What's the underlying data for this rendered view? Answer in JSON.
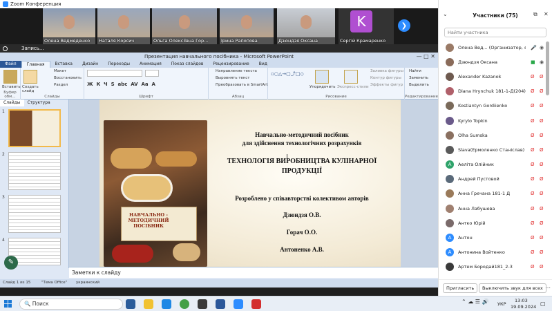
{
  "zoom_window": {
    "title": "Zoom Конференция"
  },
  "gallery": {
    "tiles": [
      {
        "name": "Олена Ведмеденко"
      },
      {
        "name": "Наталя Корсич"
      },
      {
        "name": "Ольга Олексіївна Гор..."
      },
      {
        "name": "Ірина Рапопова"
      },
      {
        "name": "Дзюндзя Оксана"
      },
      {
        "name": "Сергій Крамаренко",
        "initial": "K"
      }
    ]
  },
  "recording": {
    "label": "Запись..."
  },
  "powerpoint": {
    "window_title": "Презентация навчального посібника - Microsoft PowerPoint",
    "tabs": [
      "Файл",
      "Главная",
      "Вставка",
      "Дизайн",
      "Переходы",
      "Анимация",
      "Показ слайдов",
      "Рецензирование",
      "Вид"
    ],
    "ribbon": {
      "paste": "Вставить",
      "new_slide": "Создать слайд",
      "layout": "Макет",
      "reset": "Восстановить",
      "section": "Раздел",
      "text_direction": "Направление текста",
      "align_text": "Выровнять текст",
      "smartart": "Преобразовать в SmartArt",
      "arrange": "Упорядочить",
      "quick_styles": "Экспресс-стили",
      "shape_fill": "Заливка фигуры",
      "shape_outline": "Контур фигуры",
      "shape_effects": "Эффекты фигур",
      "find": "Найти",
      "replace": "Заменить",
      "select": "Выделить",
      "groups": [
        "Буфер обм...",
        "Слайды",
        "Шрифт",
        "Абзац",
        "Рисование",
        "Редактирование"
      ]
    },
    "left_tabs": [
      "Слайды",
      "Структура"
    ],
    "slide": {
      "lines": [
        "Навчально-методичний посібник",
        "для здійснення технологічних розрахунків",
        "ТЕХНОЛОГІЯ ВИРОБНИЦТВА КУЛІНАРНОЇ",
        "ПРОДУКЦІЇ",
        "Розроблено  у співавторстві колективом авторів",
        "Дзюндзя О.В.",
        "Горач О.О.",
        "Антоненко А.В."
      ],
      "cover_title": "НАВЧАЛЬНО - МЕТОДИЧНИЙ ПОСІБНИК"
    },
    "notes_placeholder": "Заметки к слайду",
    "status": {
      "slide": "Слайд 1 из 15",
      "theme": "\"Тема Office\"",
      "language": "украинский"
    }
  },
  "participants": {
    "title": "Участники (75)",
    "search_placeholder": "Найти участника",
    "list": [
      {
        "name": "Олена Вед... (Организатор, я)",
        "color": "#9a7a66"
      },
      {
        "name": "Дзюндзя Оксана",
        "color": "#8a6b5a"
      },
      {
        "name": "Alexander Kazanok",
        "color": "#6e5a4f"
      },
      {
        "name": "Diana Hrynchuk 181-1-Д(204)",
        "color": "#b0606a"
      },
      {
        "name": "Kostiantyn Gordiienko",
        "color": "#7a6a5a"
      },
      {
        "name": "Kyrylo Topkin",
        "color": "#6a5a8a"
      },
      {
        "name": "Olha Sumska",
        "color": "#8a7060"
      },
      {
        "name": "Slava(Ермоленко Станіслав) 18...",
        "color": "#5a5a5a"
      },
      {
        "name": "Аеліта Олійник",
        "initial": "A",
        "color": "#2ea36a"
      },
      {
        "name": "Андрей Пустовой",
        "color": "#5a6a7a"
      },
      {
        "name": "Анна Гречана 181-1 Д",
        "color": "#9a7a5a"
      },
      {
        "name": "Анна Лабушева",
        "color": "#a08070"
      },
      {
        "name": "Антко Юрій",
        "color": "#7a6a6a"
      },
      {
        "name": "Антон",
        "initial": "A",
        "color": "#2d8cff"
      },
      {
        "name": "Антонина Войтенко",
        "initial": "A",
        "color": "#2d8cff"
      },
      {
        "name": "Артем Бородай181_2-3",
        "color": "#3a3a3a"
      }
    ],
    "invite": "Пригласить",
    "mute_all": "Выключить звук для всех"
  },
  "taskbar": {
    "search": "Поиск",
    "language": "УКР",
    "time": "13:03",
    "date": "19.09.2024"
  }
}
